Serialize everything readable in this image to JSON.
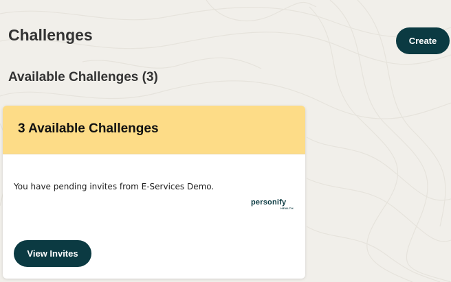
{
  "header": {
    "title": "Challenges",
    "create_label": "Create"
  },
  "section": {
    "title": "Available Challenges (3)"
  },
  "card": {
    "heading": "3 Available Challenges",
    "message": "You have pending invites from E-Services Demo.",
    "brand": {
      "name": "personify",
      "sub": "HEALTH"
    },
    "view_invites_label": "View Invites"
  },
  "colors": {
    "primary_button": "#0b3a42",
    "card_header": "#fddc87",
    "page_background": "#f1efea"
  }
}
